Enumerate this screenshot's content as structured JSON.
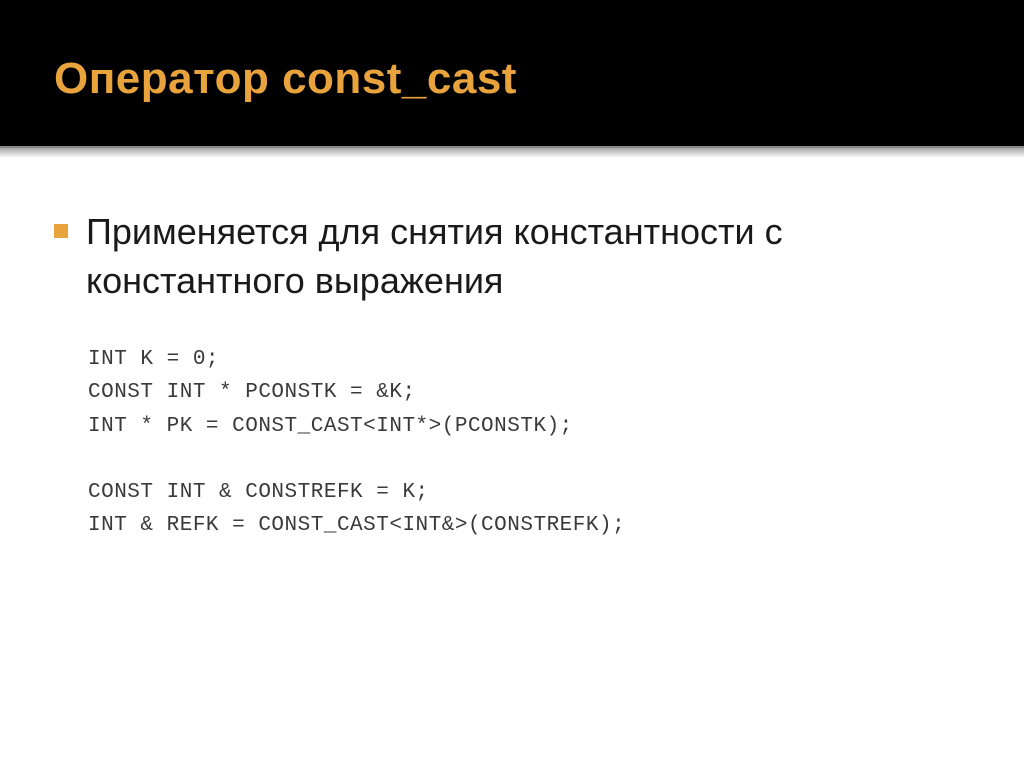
{
  "slide": {
    "title": "Оператор const_cast",
    "bullet_text": "Применяется для снятия константности с константного выражения",
    "code": {
      "line1": "int k = 0;",
      "line2": "const int * pConstK = &k;",
      "line3": "int * pK = const_cast<int*>(pConstK);",
      "line4": "const int & constRefK = k;",
      "line5": "int & refK = const_cast<int&>(constRefK);"
    }
  }
}
